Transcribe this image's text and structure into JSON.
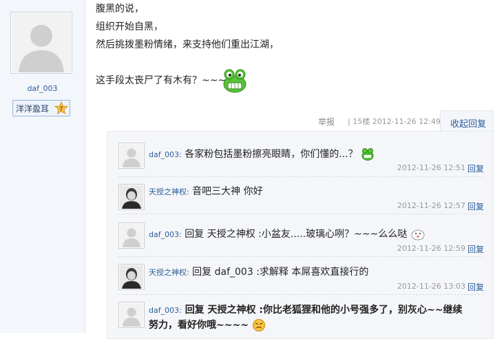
{
  "author": {
    "name": "daf_003",
    "medal_text": "洋洋盈耳",
    "medal_level": "7"
  },
  "post": {
    "lines": [
      "腹黑的说，",
      "组织开始自黑，",
      "然后挑拨墨粉情绪，来支持他们重出江湖，",
      "",
      "这手段太丧尸了有木有？~~~"
    ]
  },
  "meta": {
    "report_label": "举报",
    "floor_time": "| 15楼 2012-11-26 12:49",
    "fold_label": "收起回复"
  },
  "replies": [
    {
      "name": "daf_003",
      "text": "各家粉包括墨粉擦亮眼睛，你们懂的...？",
      "time": "2012-11-26 12:51",
      "reply_label": "回复",
      "avatar": "default"
    },
    {
      "name": "天授之神权",
      "text": "音吧三大神  你好",
      "time": "2012-11-26 12:57",
      "reply_label": "回复",
      "avatar": "portrait"
    },
    {
      "name": "daf_003",
      "text": "回复 天授之神权 :小盆友.....玻璃心咧？~~~么么哒",
      "time": "2012-11-26 12:59",
      "reply_label": "回复",
      "avatar": "default"
    },
    {
      "name": "天授之神权",
      "text": "回复 daf_003 :求解释 本屌喜欢直接行的",
      "time": "2012-11-26 13:03",
      "reply_label": "回复",
      "avatar": "portrait"
    },
    {
      "name": "daf_003",
      "text": "回复 天授之神权 :你比老狐狸和他的小号强多了，别灰心~~继续",
      "text2": "努力，看好你哦~~~~",
      "avatar": "default"
    }
  ],
  "colors": {
    "link": "#2c5d99",
    "muted": "#999999"
  }
}
